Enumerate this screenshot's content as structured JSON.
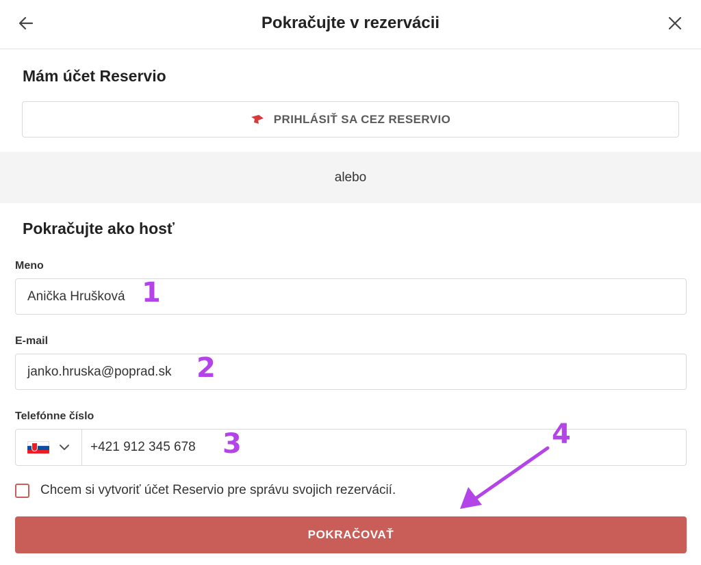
{
  "header": {
    "title": "Pokračujte v rezervácii"
  },
  "account": {
    "title": "Mám účet Reservio",
    "login_button": "PRIHLÁSIŤ SA CEZ RESERVIO"
  },
  "divider": {
    "text": "alebo"
  },
  "guest": {
    "title": "Pokračujte ako hosť",
    "name": {
      "label": "Meno",
      "value": "Anička Hrušková"
    },
    "email": {
      "label": "E-mail",
      "value": "janko.hruska@poprad.sk"
    },
    "phone": {
      "label": "Telefónne číslo",
      "value": "+421 912 345 678"
    },
    "create_account_checkbox": {
      "label": "Chcem si vytvoriť účet Reservio pre správu svojich rezervácií.",
      "checked": false
    },
    "submit": "POKRAČOVAŤ"
  },
  "annotations": [
    "1",
    "2",
    "3",
    "4"
  ],
  "colors": {
    "accent": "#c95d57",
    "annotation": "#b344e8"
  }
}
